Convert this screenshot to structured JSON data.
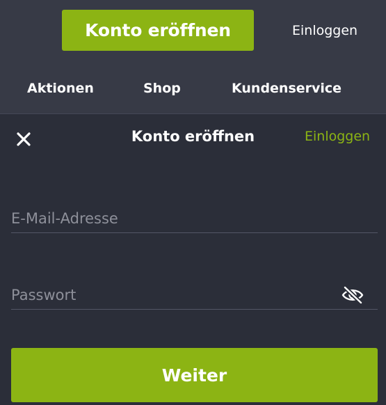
{
  "header": {
    "register_button": "Konto eröffnen",
    "login_link": "Einloggen",
    "nav": [
      "Aktionen",
      "Shop",
      "Kundenservice"
    ]
  },
  "modal": {
    "close_icon": "close-icon",
    "title": "Konto eröffnen",
    "login_link": "Einloggen",
    "email": {
      "value": "",
      "placeholder": "E-Mail-Adresse"
    },
    "password": {
      "value": "",
      "placeholder": "Passwort",
      "toggle_icon": "eye-slash-icon"
    },
    "continue_button": "Weiter"
  },
  "colors": {
    "accent": "#8cb414",
    "header_bg": "#373a46",
    "modal_bg": "#2b2e39"
  }
}
